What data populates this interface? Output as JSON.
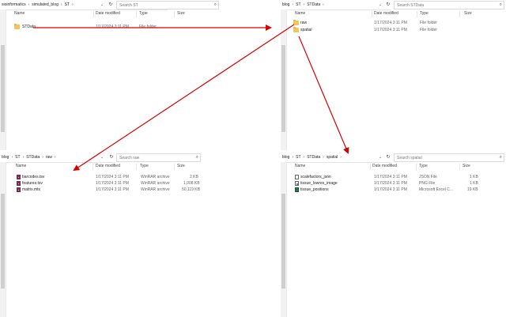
{
  "colors": {
    "arrow": "#d40000",
    "folder": "#f2c45a",
    "winrar": "#9b2b3a"
  },
  "windows": {
    "st": {
      "breadcrumb": [
        "sioinformatics",
        "simulated_blog",
        "ST"
      ],
      "search_placeholder": "Search ST",
      "columns": {
        "name": "Name",
        "date": "Date modified",
        "type": "Type",
        "size": "Size"
      },
      "items": [
        {
          "name": "STData",
          "date": "1/17/2024 3:11 PM",
          "type": "File folder",
          "size": "",
          "icon": "folder-icon"
        }
      ]
    },
    "stdata": {
      "breadcrumb": [
        "blog",
        "ST",
        "STData"
      ],
      "search_placeholder": "Search STData",
      "columns": {
        "name": "Name",
        "date": "Date modified",
        "type": "Type",
        "size": "Size"
      },
      "items": [
        {
          "name": "raw",
          "date": "1/17/2024 3:11 PM",
          "type": "File folder",
          "size": "",
          "icon": "folder-icon"
        },
        {
          "name": "spatial",
          "date": "1/17/2024 3:11 PM",
          "type": "File folder",
          "size": "",
          "icon": "folder-icon"
        }
      ]
    },
    "raw": {
      "breadcrumb": [
        "blog",
        "ST",
        "STData",
        "raw"
      ],
      "search_placeholder": "Search raw",
      "columns": {
        "name": "Name",
        "date": "Date modified",
        "type": "Type",
        "size": "Size"
      },
      "items": [
        {
          "name": "barcodes.tsv",
          "date": "1/17/2024 3:11 PM",
          "type": "WinRAR archive",
          "size": "2 KB",
          "icon": "winrar-archive-icon"
        },
        {
          "name": "features.tsv",
          "date": "1/17/2024 3:11 PM",
          "type": "WinRAR archive",
          "size": "1,008 KB",
          "icon": "winrar-archive-icon"
        },
        {
          "name": "matrix.mtx",
          "date": "1/17/2024 3:11 PM",
          "type": "WinRAR archive",
          "size": "50,119 KB",
          "icon": "winrar-archive-icon"
        }
      ]
    },
    "spatial": {
      "breadcrumb": [
        "blog",
        "ST",
        "STData",
        "spatial"
      ],
      "search_placeholder": "Search spatial",
      "columns": {
        "name": "Name",
        "date": "Date modified",
        "type": "Type",
        "size": "Size"
      },
      "items": [
        {
          "name": "scalefactors_json",
          "date": "1/17/2024 3:11 PM",
          "type": "JSON File",
          "size": "1 KB",
          "icon": "json-file-icon"
        },
        {
          "name": "tissue_lowres_image",
          "date": "1/17/2024 3:11 PM",
          "type": "PNG File",
          "size": "1 KB",
          "icon": "png-file-icon"
        },
        {
          "name": "tissue_positions",
          "date": "1/17/2024 3:11 PM",
          "type": "Microsoft Excel C...",
          "size": "19 KB",
          "icon": "excel-file-icon"
        }
      ]
    }
  }
}
